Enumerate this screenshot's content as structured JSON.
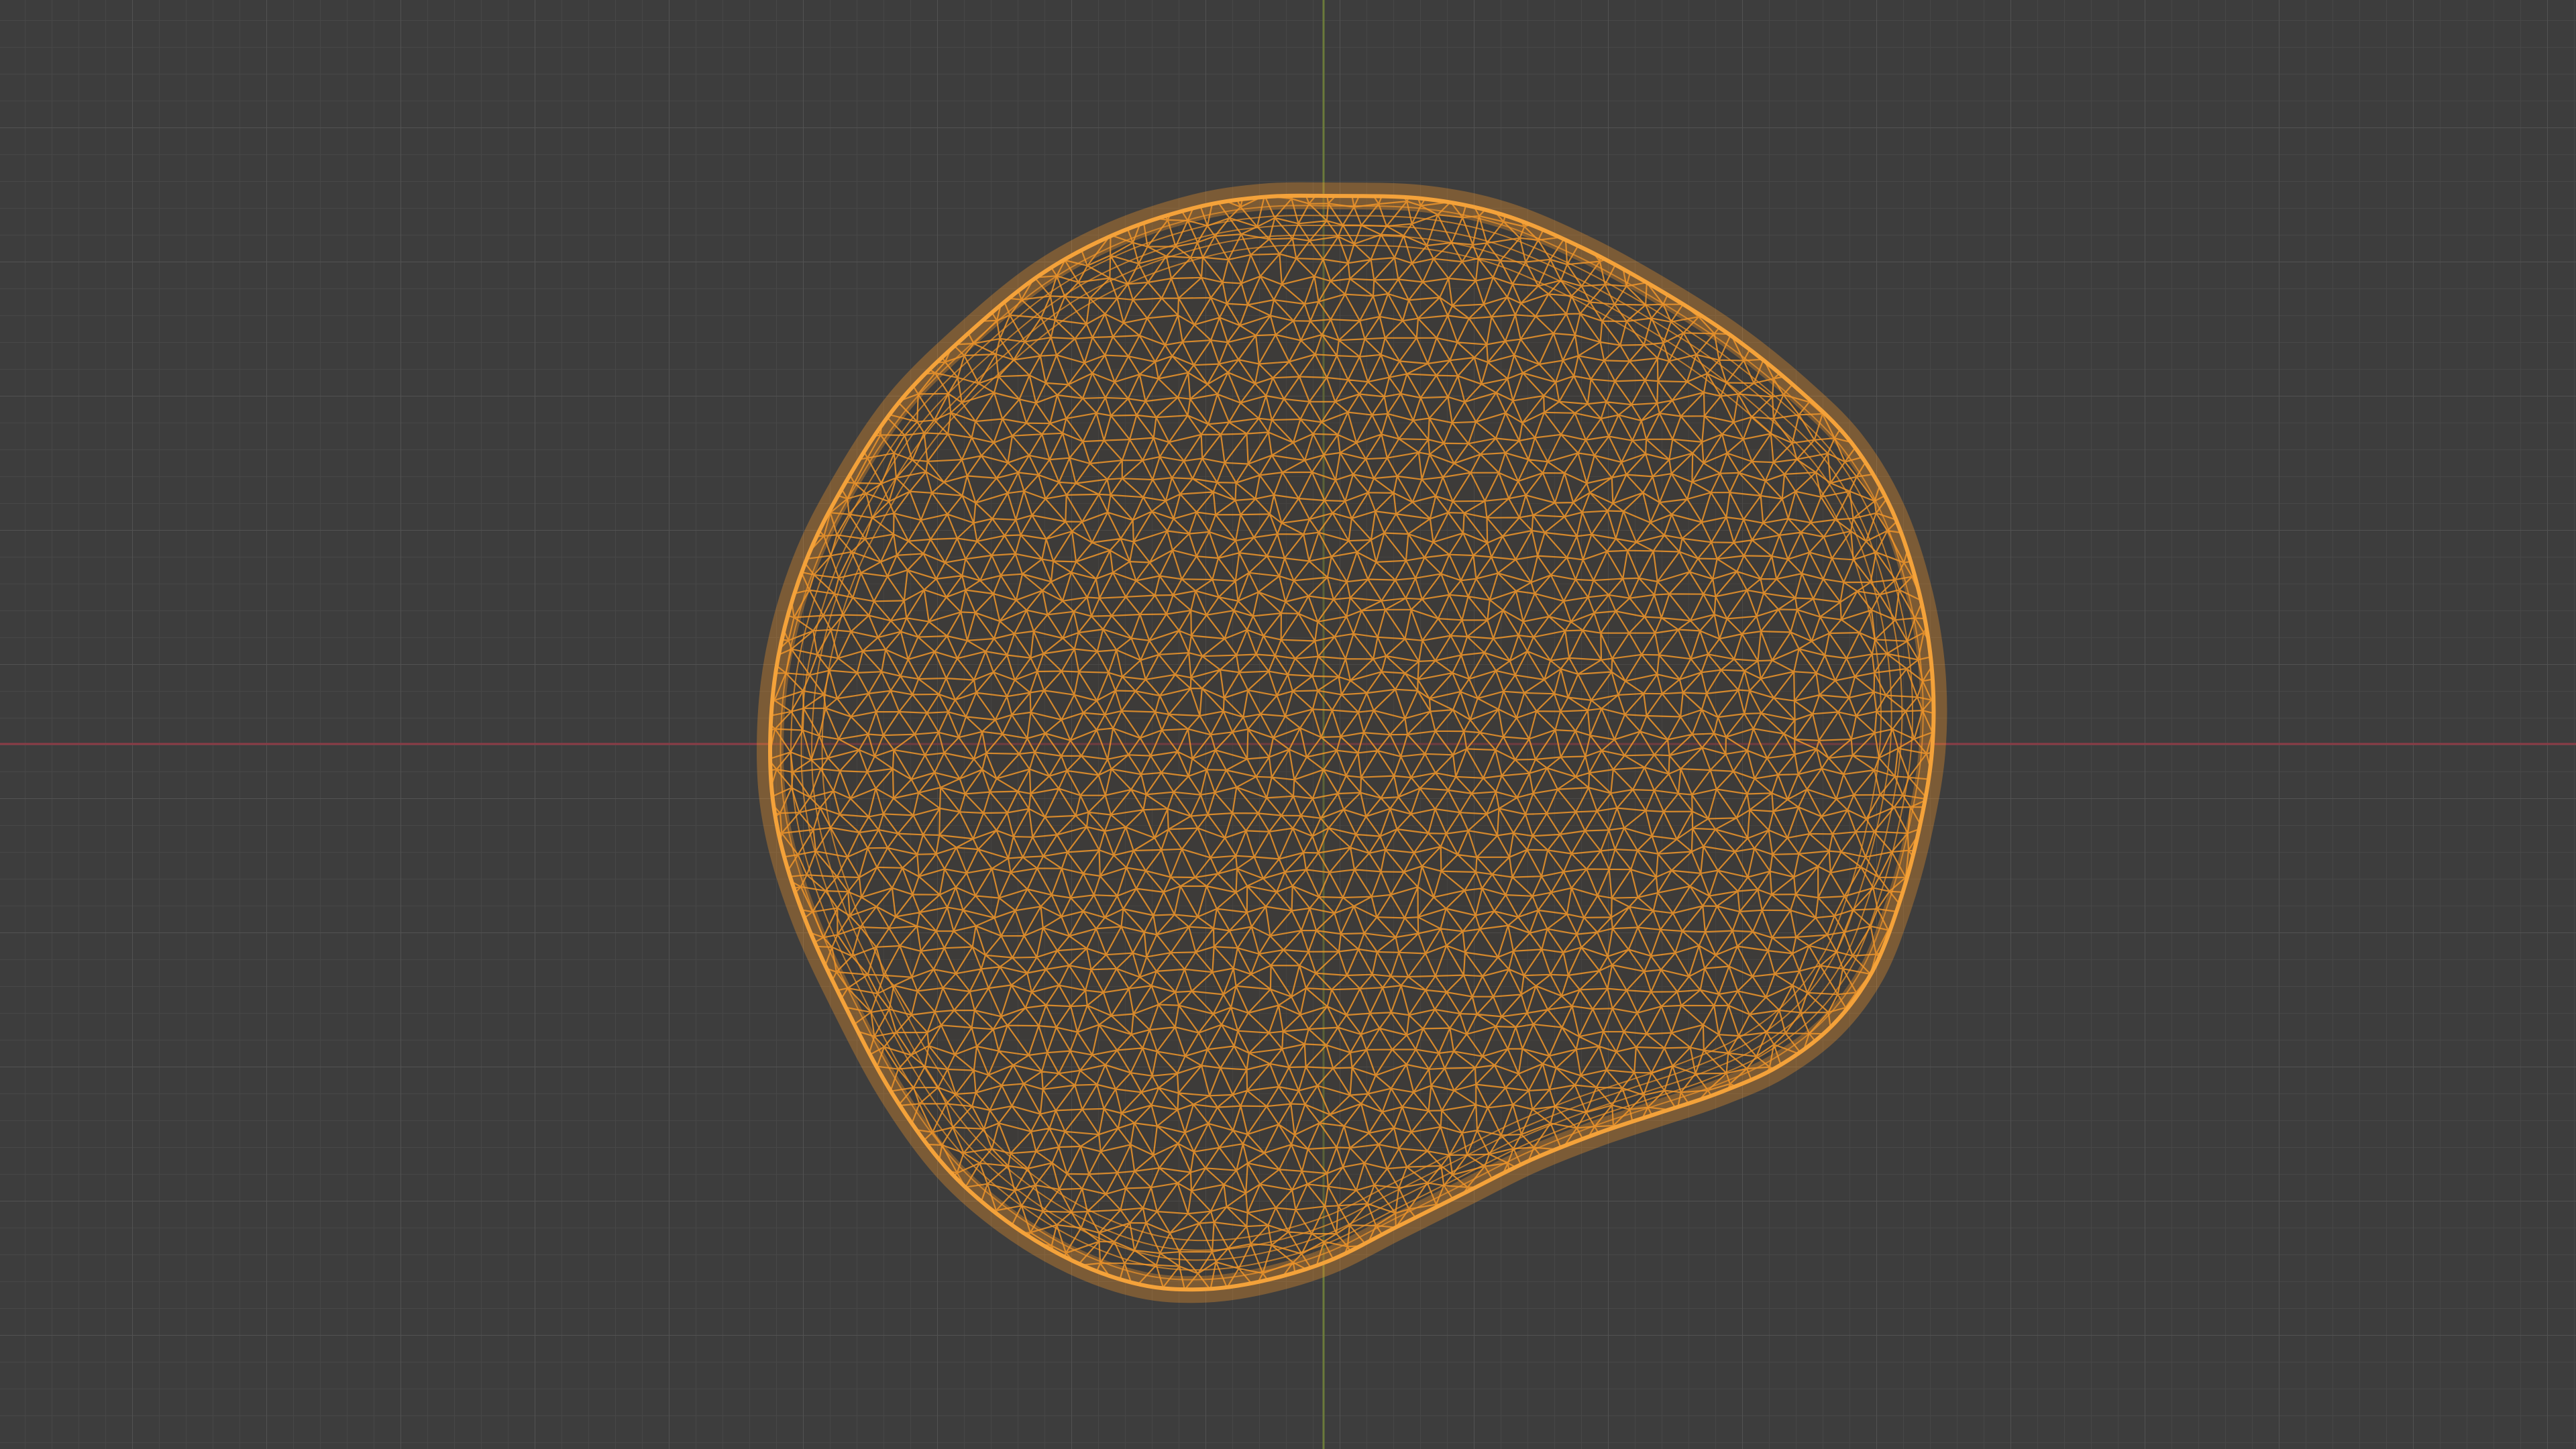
{
  "viewport": {
    "background_color": "#3d3d3d",
    "grid_minor_color": "#474747",
    "grid_major_color": "#525252",
    "x_axis_color": "#8a3c46",
    "y_axis_color": "#6b7a3a",
    "show_grid": true,
    "show_axes": true
  },
  "object": {
    "kind": "mesh",
    "display_mode": "wireframe",
    "selected": true,
    "wire_color": "#f0962a",
    "outline_color": "#f4a23a"
  }
}
